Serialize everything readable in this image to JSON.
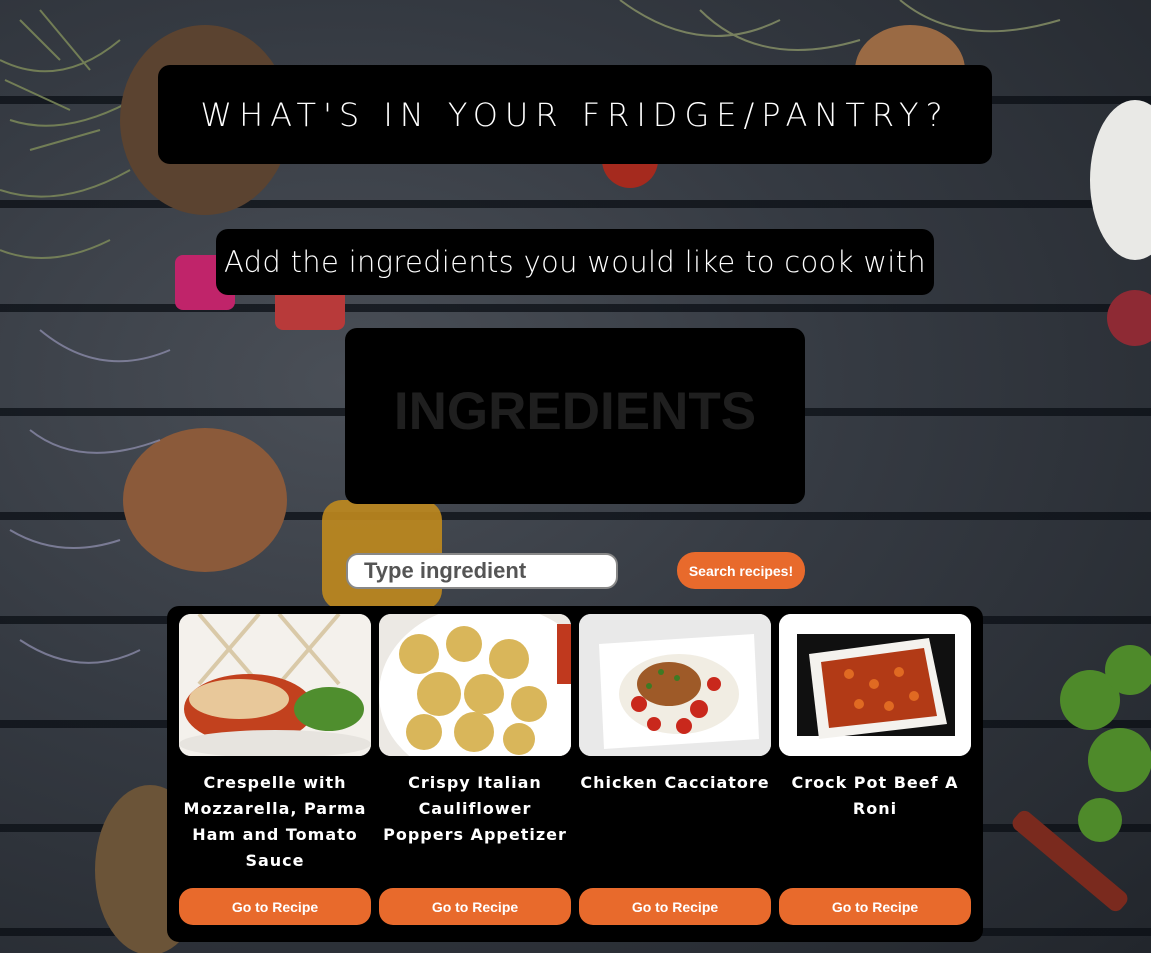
{
  "header": {
    "title": "WHAT'S IN YOUR FRIDGE/PANTRY?"
  },
  "subtitle": "Add the ingredients you would like to cook with",
  "ingredients_panel": {
    "heading": "INGREDIENTS"
  },
  "search": {
    "placeholder": "Type ingredient",
    "button_label": "Search recipes!"
  },
  "recipes": [
    {
      "name": "Crespelle with Mozzarella, Parma Ham and Tomato Sauce",
      "button_label": "Go to Recipe"
    },
    {
      "name": "Crispy Italian Cauliflower Poppers Appetizer",
      "button_label": "Go to Recipe"
    },
    {
      "name": "Chicken Cacciatore",
      "button_label": "Go to Recipe"
    },
    {
      "name": "Crock Pot Beef A Roni",
      "button_label": "Go to Recipe"
    }
  ],
  "colors": {
    "accent": "#e86a2c",
    "panel": "#000000",
    "background": "#353a42"
  }
}
